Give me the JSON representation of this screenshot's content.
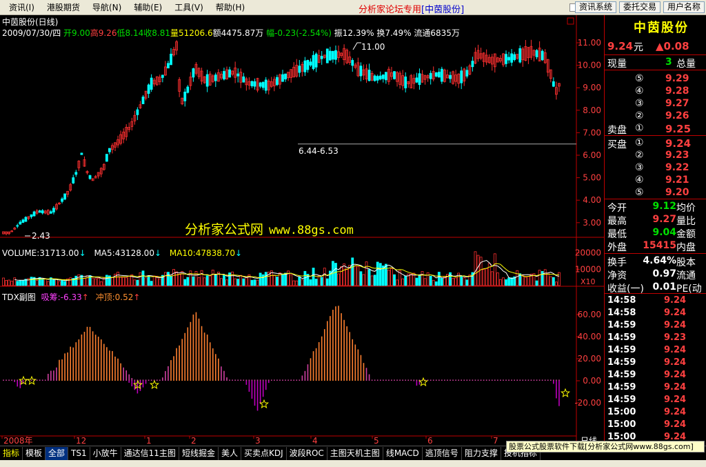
{
  "menubar": {
    "menus": [
      "资讯(I)",
      "港股期货",
      "导航(N)",
      "辅助(E)",
      "工具(V)",
      "帮助(H)"
    ],
    "title": "分析家论坛专用",
    "stock": "[中茵股份]",
    "buttons": [
      "资讯系统",
      "委托交易",
      "用户名称"
    ]
  },
  "chart": {
    "title": "中茵股份(日线)",
    "info": {
      "date": "2009/07/30/四",
      "open": "开9.00",
      "high": "高9.26",
      "low": "低8.14",
      "close": "收8.81",
      "volume": "量51206.6",
      "amount": "额4475.87万",
      "change": "幅-0.23(-2.54%)",
      "amplitude": "振12.39%",
      "turnover": "换7.49%",
      "float": "流通6835万"
    },
    "annotations": {
      "high_label": "11.00",
      "low_label": "2.43",
      "range_label": "6.44-6.53"
    },
    "watermark": {
      "text": "分析家公式网",
      "url": "www.88gs.com"
    },
    "price_axis": [
      "11.00",
      "10.00",
      "9.00",
      "8.00",
      "7.00",
      "6.00",
      "5.00",
      "4.00",
      "3.00"
    ],
    "volume_info": {
      "vol": "VOLUME:31713.00",
      "ma5": "MA5:43128.00",
      "ma10": "MA10:47838.70"
    },
    "volume_axis": [
      "20000",
      "10000"
    ],
    "volume_unit": "X10",
    "indicator_info": {
      "name": "TDX副图",
      "a": "吸筹:-6.33",
      "b": "冲顶:0.52"
    },
    "indicator_axis": [
      "60.00",
      "40.00",
      "20.00",
      "0.00",
      "-20.00"
    ],
    "date_axis": [
      "2008年",
      "12",
      "1",
      "2",
      "3",
      "4",
      "5",
      "6",
      "7"
    ],
    "period_label": "日线",
    "colors": {
      "up": "#ff3030",
      "down": "#00ffff",
      "ma5": "#ffffff",
      "ma10": "#ffff00",
      "grid": "#8b0000"
    }
  },
  "panel": {
    "name": "中茵股份",
    "price": "9.24",
    "price_unit": "元",
    "change": "▲0.08",
    "xianliang_label": "现量",
    "xianliang": "3",
    "zongliang_label": "总量",
    "sell": [
      {
        "lvl": "⑤",
        "price": "9.29"
      },
      {
        "lvl": "④",
        "price": "9.28"
      },
      {
        "lvl": "③",
        "price": "9.27"
      },
      {
        "lvl": "②",
        "price": "9.26"
      },
      {
        "lvl": "①",
        "price": "9.25"
      }
    ],
    "sell_label": "卖盘",
    "buy_label": "买盘",
    "buy": [
      {
        "lvl": "①",
        "price": "9.24"
      },
      {
        "lvl": "②",
        "price": "9.23"
      },
      {
        "lvl": "③",
        "price": "9.22"
      },
      {
        "lvl": "④",
        "price": "9.21"
      },
      {
        "lvl": "⑤",
        "price": "9.20"
      }
    ],
    "stats": [
      {
        "l": "今开",
        "v": "9.12",
        "r": "均价",
        "c": "green"
      },
      {
        "l": "最高",
        "v": "9.27",
        "r": "量比",
        "c": "red"
      },
      {
        "l": "最低",
        "v": "9.04",
        "r": "金额",
        "c": "green"
      },
      {
        "l": "外盘",
        "v": "15415",
        "r": "内盘",
        "c": "red"
      }
    ],
    "stats2": [
      {
        "l": "换手",
        "v": "4.64%",
        "r": "股本"
      },
      {
        "l": "净资",
        "v": "0.97",
        "r": "流通"
      },
      {
        "l": "收益(一)",
        "v": "0.01",
        "r": "PE(动"
      }
    ],
    "ticks": [
      {
        "t": "14:58",
        "p": "9.24"
      },
      {
        "t": "14:58",
        "p": "9.24"
      },
      {
        "t": "14:59",
        "p": "9.24"
      },
      {
        "t": "14:59",
        "p": "9.23"
      },
      {
        "t": "14:59",
        "p": "9.24"
      },
      {
        "t": "14:59",
        "p": "9.24"
      },
      {
        "t": "14:59",
        "p": "9.24"
      },
      {
        "t": "14:59",
        "p": "9.24"
      },
      {
        "t": "14:59",
        "p": "9.24"
      },
      {
        "t": "15:00",
        "p": "9.24"
      },
      {
        "t": "15:00",
        "p": "9.24"
      },
      {
        "t": "15:00",
        "p": "9.24"
      }
    ]
  },
  "tabs": [
    "指标",
    "模板",
    "全部",
    "TS1",
    "小放牛",
    "通达信11主图",
    "短线掘金",
    "美人",
    "买卖点KDJ",
    "波段ROC",
    "主图天机主图",
    "线MACD",
    "逃顶信号",
    "阻力支撑",
    "投机指标"
  ],
  "ad": "股票公式股票软件下载[分析家公式网www.88gs.com]"
}
